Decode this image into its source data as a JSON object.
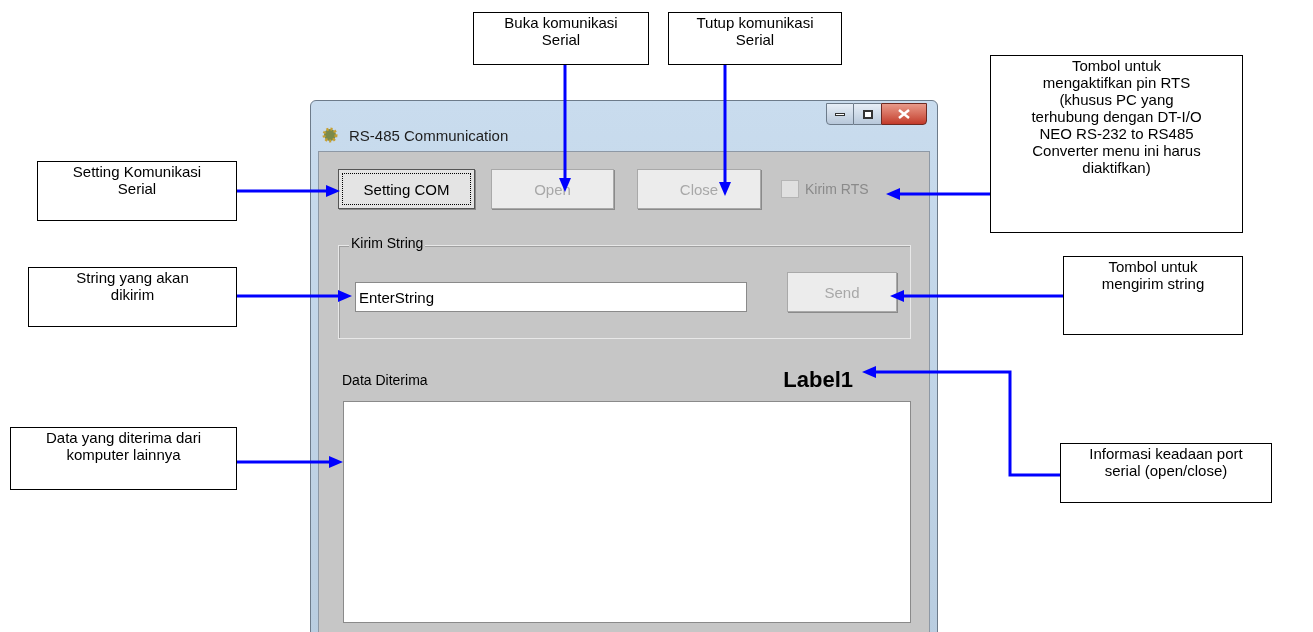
{
  "window": {
    "title": "RS-485 Communication"
  },
  "toolbar": [
    {
      "label": "Setting COM",
      "disabled": false,
      "focused": true
    },
    {
      "label": "Open",
      "disabled": true,
      "focused": false
    },
    {
      "label": "Close",
      "disabled": true,
      "focused": false
    }
  ],
  "rts": {
    "label": "Kirim RTS",
    "checked": false,
    "disabled": true
  },
  "send_group": {
    "title": "Kirim String",
    "input_value": "EnterString",
    "button": {
      "label": "Send",
      "disabled": true
    }
  },
  "received": {
    "label": "Data Diterima",
    "status": "Label1"
  },
  "annotations": [
    {
      "text": "Buka komunikasi Serial"
    },
    {
      "text": "Tutup komunikasi Serial"
    },
    {
      "text": "Tombol untuk mengaktifkan pin RTS (khusus PC yang terhubung dengan DT-I/O NEO RS-232 to RS485 Converter menu ini harus diaktifkan)"
    },
    {
      "text": "Setting Komunikasi Serial"
    },
    {
      "text": "String yang akan dikirim"
    },
    {
      "text": "Tombol untuk mengirim string"
    },
    {
      "text": "Data yang diterima dari komputer lainnya"
    },
    {
      "text": "Informasi keadaan port serial (open/close)"
    }
  ]
}
